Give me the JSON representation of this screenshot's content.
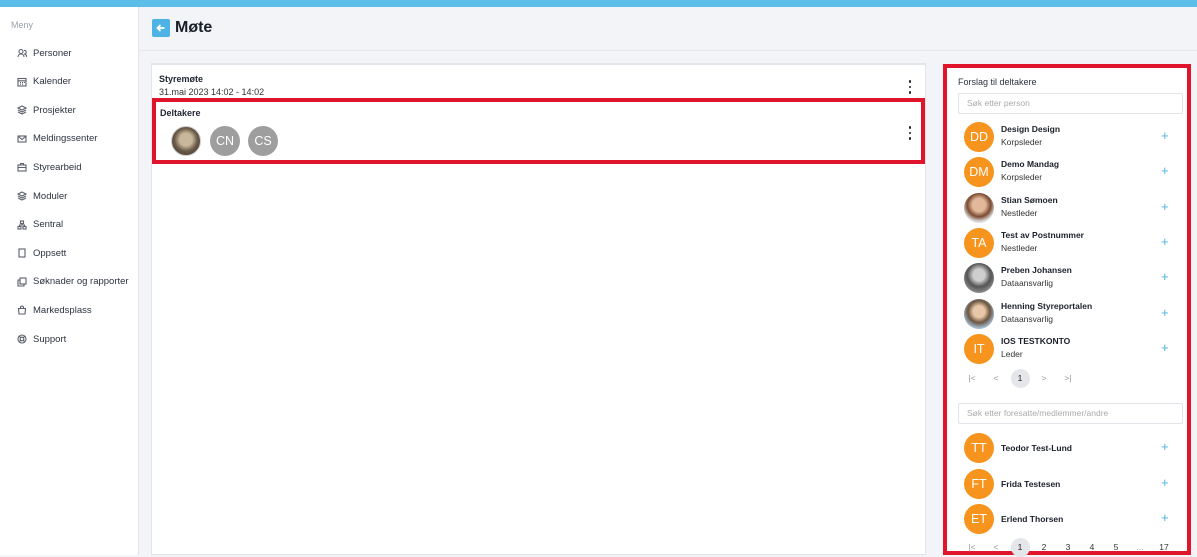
{
  "sidebar": {
    "menu_title": "Meny",
    "items": [
      {
        "label": "Personer",
        "icon": "users-icon"
      },
      {
        "label": "Kalender",
        "icon": "calendar-icon"
      },
      {
        "label": "Prosjekter",
        "icon": "layers-icon"
      },
      {
        "label": "Meldingssenter",
        "icon": "envelope-icon"
      },
      {
        "label": "Styrearbeid",
        "icon": "briefcase-icon"
      },
      {
        "label": "Moduler",
        "icon": "stack-icon"
      },
      {
        "label": "Sentral",
        "icon": "network-icon"
      },
      {
        "label": "Oppsett",
        "icon": "document-icon"
      },
      {
        "label": "Søknader og rapporter",
        "icon": "copy-icon"
      },
      {
        "label": "Markedsplass",
        "icon": "shopping-bag-icon"
      },
      {
        "label": "Support",
        "icon": "lifebuoy-icon"
      }
    ]
  },
  "header": {
    "title": "Møte"
  },
  "meeting": {
    "name": "Styremøte",
    "date": "31.mai 2023 14:02 - 14:02"
  },
  "participants": {
    "label": "Deltakere",
    "avatars": [
      {
        "type": "photo",
        "initials": ""
      },
      {
        "type": "initials",
        "initials": "CN"
      },
      {
        "type": "initials",
        "initials": "CS"
      }
    ]
  },
  "suggestions": {
    "title": "Forslag til deltakere",
    "search_placeholder": "Søk etter person",
    "people": [
      {
        "name": "Design Design",
        "role": "Korpsleder",
        "initials": "DD",
        "photo": ""
      },
      {
        "name": "Demo Mandag",
        "role": "Korpsleder",
        "initials": "DM",
        "photo": ""
      },
      {
        "name": "Stian Sømoen",
        "role": "Nestleder",
        "initials": "",
        "photo": "ph1"
      },
      {
        "name": "Test av Postnummer",
        "role": "Nestleder",
        "initials": "TA",
        "photo": ""
      },
      {
        "name": "Preben Johansen",
        "role": "Dataansvarlig",
        "initials": "",
        "photo": "ph2"
      },
      {
        "name": "Henning Styreportalen",
        "role": "Dataansvarlig",
        "initials": "",
        "photo": "ph3"
      },
      {
        "name": "IOS TESTKONTO",
        "role": "Leder",
        "initials": "IT",
        "photo": ""
      }
    ],
    "pager": {
      "first": "|<",
      "prev": "<",
      "current": "1",
      "next": ">",
      "last": ">|"
    }
  },
  "others": {
    "search_placeholder": "Søk etter foresatte/medlemmer/andre",
    "people": [
      {
        "name": "Teodor Test-Lund",
        "initials": "TT"
      },
      {
        "name": "Frida Testesen",
        "initials": "FT"
      },
      {
        "name": "Erlend Thorsen",
        "initials": "ET"
      }
    ],
    "pager": {
      "first": "|<",
      "prev": "<",
      "pages": [
        "1",
        "2",
        "3",
        "4",
        "5"
      ],
      "ellipsis": "...",
      "last_page": "17"
    }
  },
  "colors": {
    "accent": "#4db3e4",
    "orange": "#f7941d",
    "highlight": "#e0142a",
    "topbar": "#5bbde8"
  },
  "add_symbol": "+"
}
